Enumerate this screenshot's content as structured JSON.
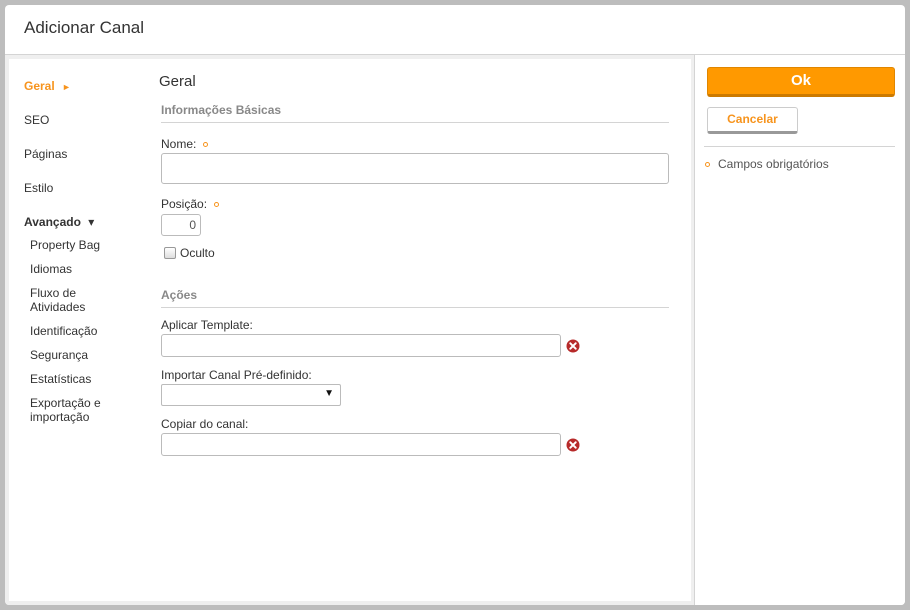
{
  "dialog": {
    "title": "Adicionar Canal"
  },
  "nav": {
    "items": [
      {
        "label": "Geral",
        "active": true,
        "marker": "►"
      },
      {
        "label": "SEO"
      },
      {
        "label": "Páginas"
      },
      {
        "label": "Estilo"
      }
    ],
    "group": {
      "label": "Avançado",
      "marker": "▾"
    },
    "sub_items": [
      "Property Bag",
      "Idiomas",
      "Fluxo de Atividades",
      "Identificação",
      "Segurança",
      "Estatísticas",
      "Exportação e importação"
    ]
  },
  "main": {
    "section_title": "Geral",
    "basic_info": {
      "legend": "Informações Básicas",
      "name_label": "Nome:",
      "name_value": "",
      "position_label": "Posição:",
      "position_value": "0",
      "hidden_label": "Oculto"
    },
    "actions": {
      "legend": "Ações",
      "apply_template_label": "Aplicar Template:",
      "apply_template_value": "",
      "import_label": "Importar Canal Pré-definido:",
      "import_value": "",
      "copy_label": "Copiar do canal:",
      "copy_value": ""
    }
  },
  "sidebar_right": {
    "ok_label": "Ok",
    "cancel_label": "Cancelar",
    "required_note": "Campos obrigatórios"
  },
  "colors": {
    "accent": "#f7941d",
    "ok_button": "#ff9900",
    "clear_icon": "#b72a2a"
  },
  "icons": {
    "clear": "close-circle-icon",
    "required": "required-dot-icon",
    "dropdown": "caret-down-icon"
  }
}
